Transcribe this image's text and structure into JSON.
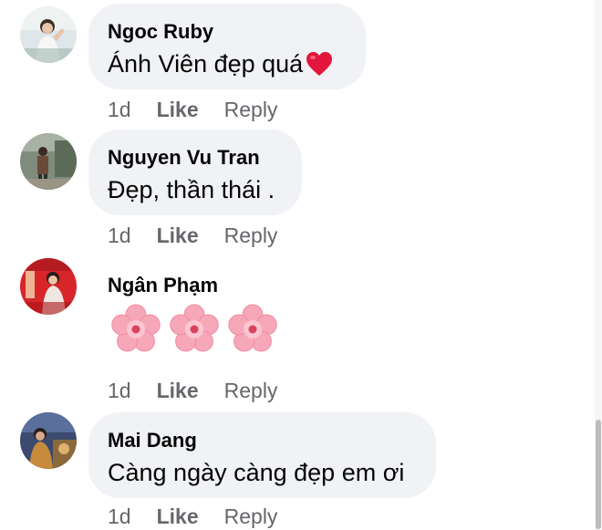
{
  "comments": [
    {
      "author": "Ngoc Ruby",
      "text": "Ánh Viên đẹp quá",
      "emoji": "heart-icon",
      "time": "1d",
      "like_label": "Like",
      "reply_label": "Reply"
    },
    {
      "author": "Nguyen Vu Tran",
      "text": "Đẹp, thần thái .",
      "time": "1d",
      "like_label": "Like",
      "reply_label": "Reply"
    },
    {
      "author": "Ngân Phạm",
      "emoji": "cherry-blossom-icon",
      "emoji_count": 3,
      "time": "1d",
      "like_label": "Like",
      "reply_label": "Reply"
    },
    {
      "author": "Mai Dang",
      "text": "Càng ngày càng đẹp em ơi",
      "time": "1d",
      "like_label": "Like",
      "reply_label": "Reply"
    }
  ],
  "colors": {
    "bubble_bg": "#f0f2f5",
    "text": "#050505",
    "meta": "#65676b",
    "heart": "#e4163d",
    "blossom": "#f7a8b8"
  }
}
